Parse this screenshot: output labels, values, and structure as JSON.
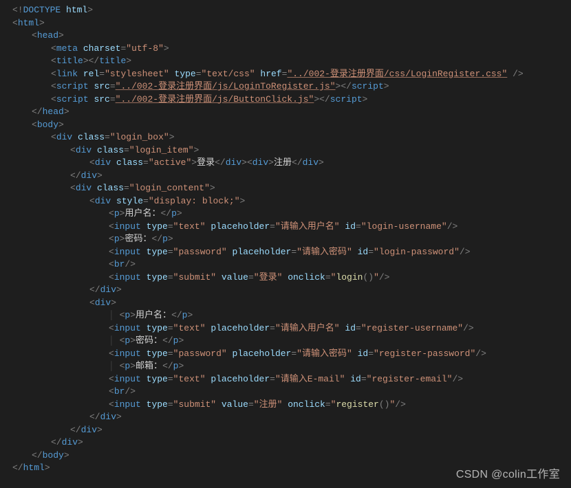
{
  "watermark": "CSDN @colin工作室",
  "code": {
    "doctype": "html",
    "htmlTag": "html",
    "headTag": "head",
    "bodyTag": "body",
    "metaTag": "meta",
    "titleTag": "title",
    "linkTag": "link",
    "scriptTag": "script",
    "divTag": "div",
    "pTag": "p",
    "inputTag": "input",
    "brTag": "br",
    "attrs": {
      "charset": "charset",
      "rel": "rel",
      "type": "type",
      "href": "href",
      "src": "src",
      "class": "class",
      "style": "style",
      "placeholder": "placeholder",
      "id": "id",
      "value": "value",
      "onclick": "onclick"
    },
    "values": {
      "charset": "utf-8",
      "rel": "stylesheet",
      "typeCss": "text/css",
      "href": "../002-登录注册界面/css/LoginRegister.css",
      "src1": "../002-登录注册界面/js/LoginToRegister.js",
      "src2": "../002-登录注册界面/js/ButtonClick.js",
      "classLoginBox": "login_box",
      "classLoginItem": "login_item",
      "classActive": "active",
      "classLoginContent": "login_content",
      "styleDisplayBlock": "display: block;",
      "typeText": "text",
      "typePassword": "password",
      "typeSubmit": "submit",
      "phUsername": "请输入用户名",
      "phPassword": "请输入密码",
      "phEmail": "请输入E-mail",
      "idLoginUsername": "login-username",
      "idLoginPassword": "login-password",
      "idRegUsername": "register-username",
      "idRegPassword": "register-password",
      "idRegEmail": "register-email",
      "valLogin": "登录",
      "valRegister": "注册",
      "onclickLogin": "login",
      "onclickRegister": "register"
    },
    "text": {
      "tabLogin": "登录",
      "tabRegister": "注册",
      "labelUsername": "用户名：",
      "labelPassword": "密码：",
      "labelEmail": "邮箱："
    }
  }
}
